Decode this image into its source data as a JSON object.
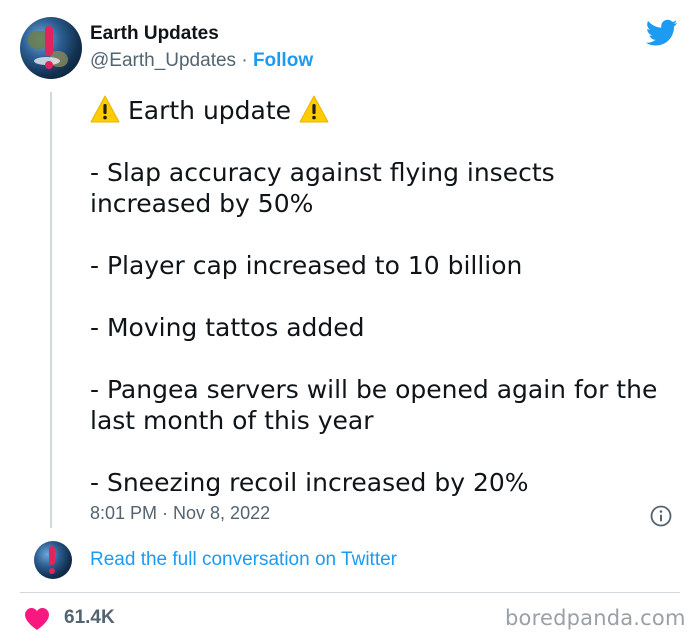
{
  "author": {
    "display_name": "Earth Updates",
    "handle": "@Earth_Updates",
    "separator": " · ",
    "follow_label": "Follow"
  },
  "tweet": {
    "title": "Earth update",
    "lines": [
      "- Slap accuracy against flying insects increased by 50%",
      "- Player cap increased to 10 billion",
      "- Moving tattos added",
      "- Pangea servers will be opened again for the last month of this year",
      "- Sneezing recoil increased by 20%"
    ],
    "timestamp": "8:01 PM · Nov 8, 2022"
  },
  "footer": {
    "read_link": "Read the full conversation on Twitter",
    "likes": "61.4K",
    "watermark": "boredpanda.com"
  },
  "colors": {
    "accent": "#1d9bf0",
    "heart": "#f91880",
    "secondary_text": "#536471",
    "warning": "#ffcc00"
  },
  "icons": [
    "twitter-bird-icon",
    "warning-icon",
    "info-icon",
    "heart-icon"
  ]
}
